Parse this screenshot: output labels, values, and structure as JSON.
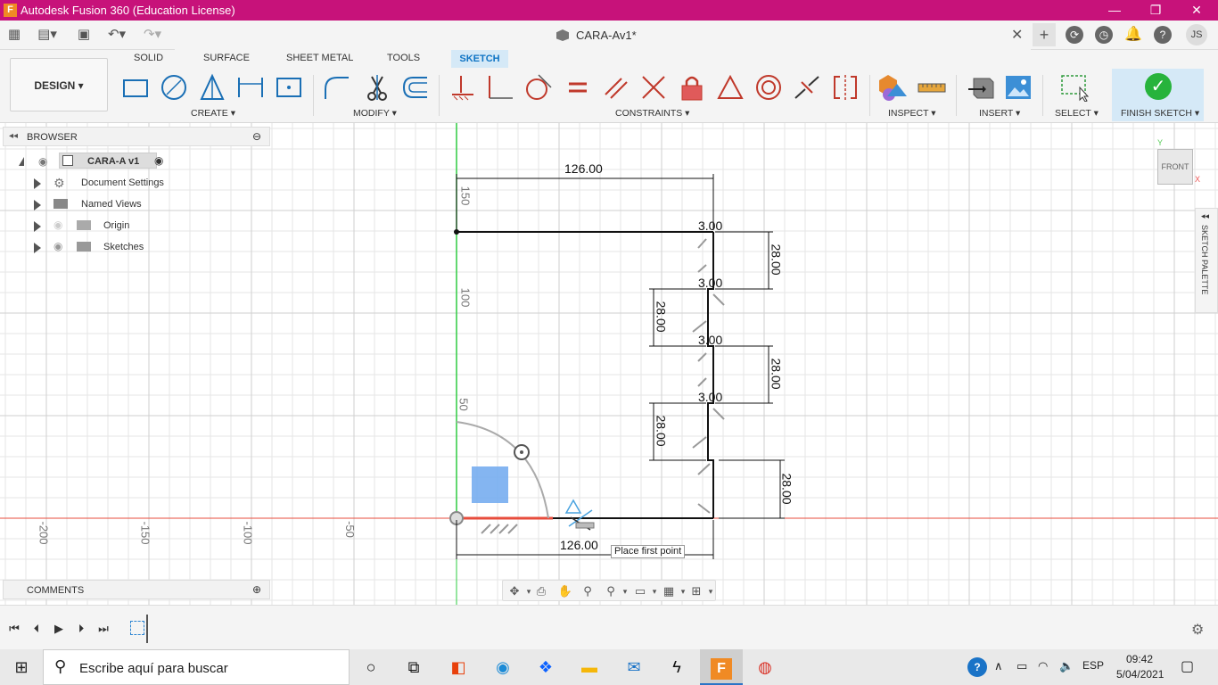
{
  "window": {
    "title": "Autodesk Fusion 360 (Education License)",
    "controls": [
      "—",
      "❐",
      "✕"
    ]
  },
  "document": {
    "tab_title": "CARA-Av1*",
    "user_initials": "JS"
  },
  "toolbar": {
    "workspace": "DESIGN",
    "tabs": [
      "SOLID",
      "SURFACE",
      "SHEET METAL",
      "TOOLS",
      "SKETCH"
    ],
    "groups": {
      "create": "CREATE",
      "modify": "MODIFY",
      "constraints": "CONSTRAINTS",
      "inspect": "INSPECT",
      "insert": "INSERT",
      "select": "SELECT",
      "finish": "FINISH SKETCH"
    }
  },
  "browser": {
    "title": "BROWSER",
    "root": "CARA-A v1",
    "items": [
      "Document Settings",
      "Named Views",
      "Origin",
      "Sketches"
    ]
  },
  "comments": {
    "title": "COMMENTS"
  },
  "canvas": {
    "viewcube_label": "FRONT",
    "sketch_palette": "SKETCH PALETTE",
    "tooltip": "Place first point",
    "axis_labels": [
      "-200",
      "-150",
      "-100",
      "-50",
      "50",
      "100",
      "150"
    ],
    "dimensions": [
      "126.00",
      "126.00",
      "3.00",
      "3.00",
      "3.00",
      "3.00",
      "28.00",
      "28.00",
      "28.00",
      "28.00",
      "28.00"
    ]
  },
  "taskbar": {
    "search_placeholder": "Escribe aquí para buscar",
    "language": "ESP",
    "time": "09:42",
    "date": "5/04/2021"
  }
}
